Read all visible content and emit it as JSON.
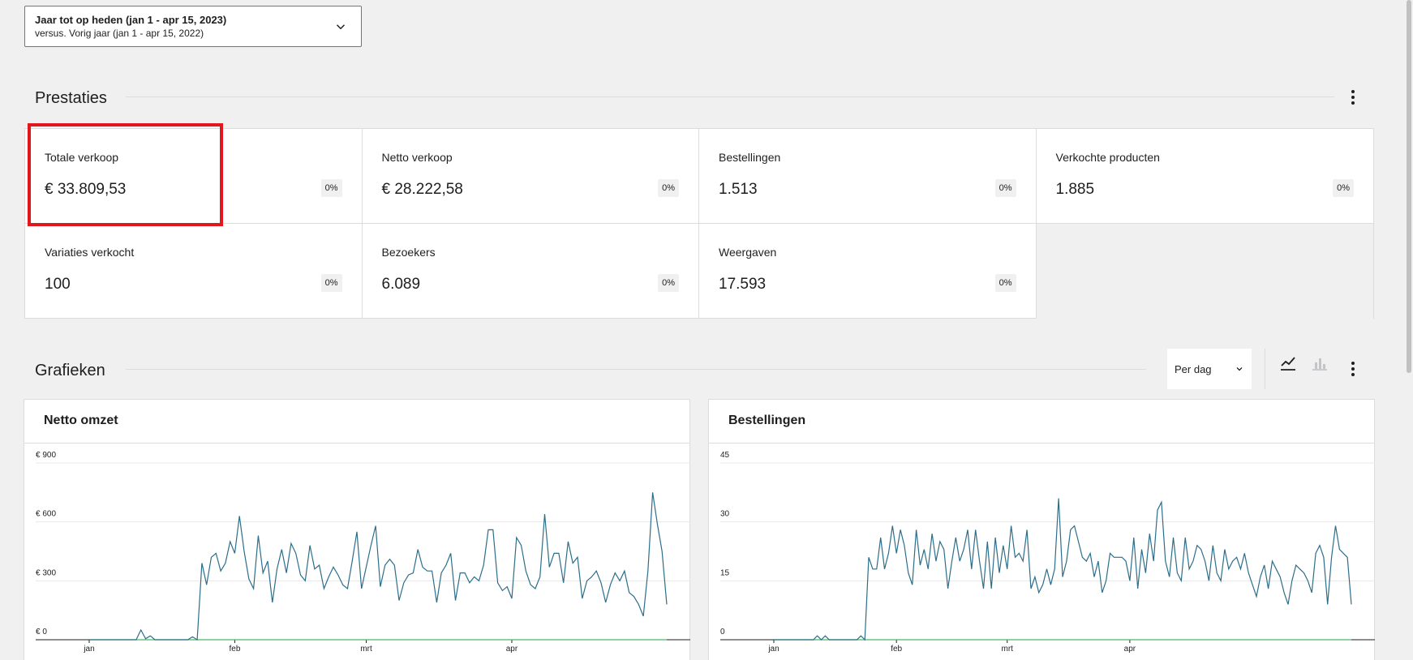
{
  "date_picker": {
    "main": "Jaar tot op heden (jan 1 - apr 15, 2023)",
    "sub": "versus. Vorig jaar (jan 1 - apr 15, 2022)"
  },
  "performance": {
    "title": "Prestaties",
    "tiles": [
      {
        "label": "Totale verkoop",
        "value": "€ 33.809,53",
        "delta": "0%"
      },
      {
        "label": "Netto verkoop",
        "value": "€ 28.222,58",
        "delta": "0%"
      },
      {
        "label": "Bestellingen",
        "value": "1.513",
        "delta": "0%"
      },
      {
        "label": "Verkochte producten",
        "value": "1.885",
        "delta": "0%"
      },
      {
        "label": "Variaties verkocht",
        "value": "100",
        "delta": "0%"
      },
      {
        "label": "Bezoekers",
        "value": "6.089",
        "delta": "0%"
      },
      {
        "label": "Weergaven",
        "value": "17.593",
        "delta": "0%"
      }
    ]
  },
  "charts_section": {
    "title": "Grafieken",
    "interval": "Per dag",
    "icons": {
      "line": "line-chart-icon",
      "bar": "bar-chart-icon",
      "more": "more-vertical-icon"
    }
  },
  "colors": {
    "current": "#2c6e8a",
    "previous": "#4ab866",
    "highlight": "#e2161e"
  },
  "chart_data": [
    {
      "type": "line",
      "title": "Netto omzet",
      "y_ticks": [
        "€ 0",
        "€ 300",
        "€ 600",
        "€ 900"
      ],
      "ylim": [
        0,
        900
      ],
      "x_ticks": [
        {
          "label": "jan",
          "day": 1
        },
        {
          "label": "feb",
          "day": 32
        },
        {
          "label": "mrt",
          "day": 60
        },
        {
          "label": "apr",
          "day": 91
        }
      ],
      "grid": true,
      "series": [
        {
          "values": [
            0,
            0,
            0,
            0,
            0,
            0,
            0,
            0,
            0,
            0,
            0,
            50,
            5,
            20,
            0,
            0,
            0,
            0,
            0,
            0,
            0,
            0,
            15,
            0,
            390,
            280,
            420,
            440,
            350,
            390,
            500,
            440,
            630,
            450,
            310,
            260,
            530,
            340,
            400,
            190,
            360,
            460,
            340,
            490,
            440,
            330,
            300,
            480,
            360,
            380,
            260,
            320,
            370,
            330,
            280,
            260,
            400,
            550,
            260,
            370,
            480,
            580,
            270,
            380,
            410,
            380,
            200,
            290,
            330,
            340,
            460,
            370,
            350,
            350,
            190,
            340,
            380,
            440,
            200,
            340,
            340,
            290,
            320,
            300,
            380,
            560,
            560,
            290,
            250,
            270,
            210,
            520,
            480,
            350,
            280,
            260,
            320,
            640,
            370,
            440,
            440,
            290,
            500,
            390,
            420,
            210,
            300,
            320,
            350,
            290,
            190,
            280,
            340,
            300,
            350,
            240,
            220,
            180,
            120,
            350,
            750,
            590,
            450,
            180
          ]
        },
        {
          "values": [
            0,
            0,
            0,
            0,
            0,
            0,
            0,
            0,
            0,
            0,
            0,
            0,
            0,
            0,
            0,
            0,
            0,
            0,
            0,
            0,
            0,
            0,
            0,
            0,
            0,
            0,
            0,
            0,
            0,
            0,
            0,
            0,
            0,
            0,
            0,
            0,
            0,
            0,
            0,
            0,
            0,
            0,
            0,
            0,
            0,
            0,
            0,
            0,
            0,
            0,
            0,
            0,
            0,
            0,
            0,
            0,
            0,
            0,
            0,
            0,
            0,
            0,
            0,
            0,
            0,
            0,
            0,
            0,
            0,
            0,
            0,
            0,
            0,
            0,
            0,
            0,
            0,
            0,
            0,
            0,
            0,
            0,
            0,
            0,
            0,
            0,
            0,
            0,
            0,
            0,
            0,
            0,
            0,
            0,
            0,
            0,
            0,
            0,
            0,
            0,
            0,
            0,
            0,
            0,
            0,
            0,
            0,
            0,
            0,
            0,
            0,
            0,
            0,
            0,
            0,
            0,
            0,
            0,
            0,
            0,
            0,
            0,
            0,
            0
          ]
        }
      ]
    },
    {
      "type": "line",
      "title": "Bestellingen",
      "y_ticks": [
        "0",
        "15",
        "30",
        "45"
      ],
      "ylim": [
        0,
        45
      ],
      "x_ticks": [
        {
          "label": "jan",
          "day": 1
        },
        {
          "label": "feb",
          "day": 32
        },
        {
          "label": "mrt",
          "day": 60
        },
        {
          "label": "apr",
          "day": 91
        }
      ],
      "grid": true,
      "series": [
        {
          "values": [
            0,
            0,
            0,
            0,
            0,
            0,
            0,
            0,
            0,
            0,
            0,
            1,
            0,
            1,
            0,
            0,
            0,
            0,
            0,
            0,
            0,
            0,
            1,
            0,
            21,
            18,
            18,
            26,
            18,
            22,
            29,
            22,
            28,
            24,
            17,
            14,
            28,
            19,
            23,
            18,
            27,
            20,
            25,
            23,
            13,
            20,
            26,
            20,
            23,
            28,
            18,
            28,
            20,
            13,
            25,
            13,
            26,
            17,
            24,
            18,
            29,
            21,
            22,
            20,
            28,
            13,
            16,
            12,
            14,
            18,
            14,
            18,
            36,
            16,
            20,
            28,
            29,
            25,
            21,
            20,
            22,
            16,
            20,
            12,
            15,
            22,
            21,
            21,
            21,
            20,
            15,
            26,
            13,
            23,
            17,
            27,
            20,
            33,
            35,
            20,
            16,
            26,
            17,
            15,
            26,
            18,
            20,
            24,
            23,
            20,
            15,
            24,
            17,
            15,
            23,
            18,
            20,
            21,
            18,
            22,
            17,
            14,
            11,
            16,
            19,
            13,
            20,
            18,
            16,
            12,
            9,
            15,
            19,
            18,
            17,
            15,
            12,
            22,
            24,
            21,
            9,
            21,
            29,
            23,
            22,
            21,
            9
          ]
        },
        {
          "values": [
            0,
            0,
            0,
            0,
            0,
            0,
            0,
            0,
            0,
            0,
            0,
            0,
            0,
            0,
            0,
            0,
            0,
            0,
            0,
            0,
            0,
            0,
            0,
            0,
            0,
            0,
            0,
            0,
            0,
            0,
            0,
            0,
            0,
            0,
            0,
            0,
            0,
            0,
            0,
            0,
            0,
            0,
            0,
            0,
            0,
            0,
            0,
            0,
            0,
            0,
            0,
            0,
            0,
            0,
            0,
            0,
            0,
            0,
            0,
            0,
            0,
            0,
            0,
            0,
            0,
            0,
            0,
            0,
            0,
            0,
            0,
            0,
            0,
            0,
            0,
            0,
            0,
            0,
            0,
            0,
            0,
            0,
            0,
            0,
            0,
            0,
            0,
            0,
            0,
            0,
            0,
            0,
            0,
            0,
            0,
            0,
            0,
            0,
            0,
            0,
            0,
            0,
            0,
            0,
            0,
            0,
            0,
            0,
            0,
            0,
            0,
            0,
            0,
            0,
            0,
            0,
            0,
            0,
            0,
            0,
            0,
            0,
            0,
            0,
            0,
            0,
            0,
            0,
            0,
            0,
            0,
            0,
            0,
            0,
            0,
            0,
            0,
            0,
            0,
            0,
            0,
            0,
            0,
            0,
            0,
            0,
            0,
            0,
            0,
            0,
            0,
            0,
            0,
            0,
            0
          ]
        }
      ]
    }
  ]
}
